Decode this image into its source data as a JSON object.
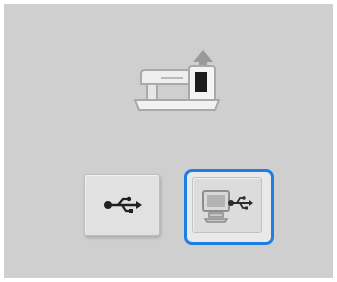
{
  "panel": {
    "header_icon": "sewing-machine-upload-icon",
    "buttons": [
      {
        "icon": "usb-icon"
      },
      {
        "icon": "usb-computer-icon",
        "selected": true
      }
    ]
  },
  "colors": {
    "panel_bg": "#cfcfcf",
    "selection_border": "#1f7ee6"
  }
}
